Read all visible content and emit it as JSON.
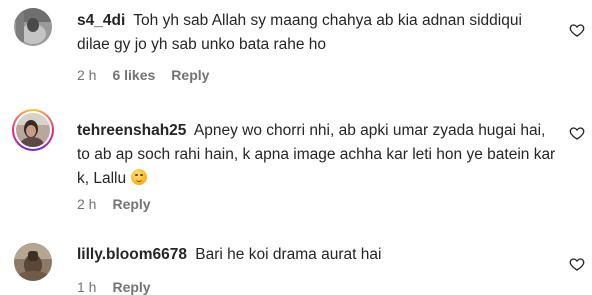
{
  "comments": [
    {
      "username": "s4_4di",
      "text": "Toh yh sab Allah sy maang chahya ab kia adnan siddiqui dilae gy jo yh sab unko bata rahe ho",
      "time": "2 h",
      "likes": "6 likes",
      "reply": "Reply",
      "avatar_icon": "avatar-photo-gray",
      "has_story_ring": false
    },
    {
      "username": "tehreenshah25",
      "text": "Apney wo chorri nhi, ab apki umar zyada hugai hai, to ab ap soch rahi hain, k apna image achha kar leti hon ye batein kar k, Lallu",
      "emoji": "smiling-face-emoji",
      "time": "2 h",
      "reply": "Reply",
      "avatar_icon": "avatar-photo-woman",
      "has_story_ring": true
    },
    {
      "username": "lilly.bloom6678",
      "text": "Bari he koi drama aurat hai",
      "time": "1 h",
      "reply": "Reply",
      "avatar_icon": "avatar-photo-brown",
      "has_story_ring": false
    }
  ],
  "icons": {
    "like": "heart-outline-icon"
  },
  "colors": {
    "text": "#262626",
    "meta": "#737373",
    "ring_start": "#f9ce34",
    "ring_mid": "#ee2a7b",
    "ring_end": "#6228d7"
  }
}
